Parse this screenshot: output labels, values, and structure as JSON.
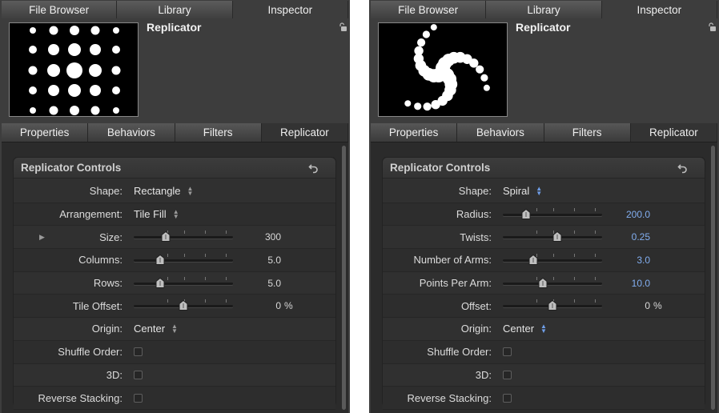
{
  "left": {
    "top_tabs": [
      "File Browser",
      "Library",
      "Inspector"
    ],
    "title": "Replicator",
    "sub_tabs": [
      "Properties",
      "Behaviors",
      "Filters",
      "Replicator"
    ],
    "section_title": "Replicator Controls",
    "shape": {
      "label": "Shape:",
      "value": "Rectangle"
    },
    "arrangement": {
      "label": "Arrangement:",
      "value": "Tile Fill"
    },
    "size": {
      "label": "Size:",
      "value": "300",
      "level": 0.32
    },
    "columns": {
      "label": "Columns:",
      "value": "5.0",
      "level": 0.27
    },
    "rows": {
      "label": "Rows:",
      "value": "5.0",
      "level": 0.27
    },
    "tile_offset": {
      "label": "Tile Offset:",
      "value": "0",
      "unit": "%",
      "level": 0.5
    },
    "origin": {
      "label": "Origin:",
      "value": "Center"
    },
    "shuffle_order": {
      "label": "Shuffle Order:",
      "checked": false
    },
    "three_d": {
      "label": "3D:",
      "checked": false
    },
    "reverse_stacking": {
      "label": "Reverse Stacking:",
      "checked": false
    }
  },
  "right": {
    "top_tabs": [
      "File Browser",
      "Library",
      "Inspector"
    ],
    "title": "Replicator",
    "sub_tabs": [
      "Properties",
      "Behaviors",
      "Filters",
      "Replicator"
    ],
    "section_title": "Replicator Controls",
    "shape": {
      "label": "Shape:",
      "value": "Spiral"
    },
    "radius": {
      "label": "Radius:",
      "value": "200.0",
      "level": 0.23
    },
    "twists": {
      "label": "Twists:",
      "value": "0.25",
      "level": 0.55
    },
    "number_of_arms": {
      "label": "Number of Arms:",
      "value": "3.0",
      "level": 0.31
    },
    "points_per_arm": {
      "label": "Points Per Arm:",
      "value": "10.0",
      "level": 0.4
    },
    "offset": {
      "label": "Offset:",
      "value": "0",
      "unit": "%",
      "level": 0.5
    },
    "origin": {
      "label": "Origin:",
      "value": "Center"
    },
    "shuffle_order": {
      "label": "Shuffle Order:",
      "checked": false
    },
    "three_d": {
      "label": "3D:",
      "checked": false
    },
    "reverse_stacking": {
      "label": "Reverse Stacking:",
      "checked": false
    }
  },
  "colors": {
    "panel": "#3d3d3d",
    "content": "#2b2b2b",
    "accent_blue": "#82aef0"
  },
  "icons": [
    "lock-icon",
    "reset-icon",
    "disclosure-triangle-icon",
    "popup-arrows-icon",
    "slider-knob-icon"
  ]
}
